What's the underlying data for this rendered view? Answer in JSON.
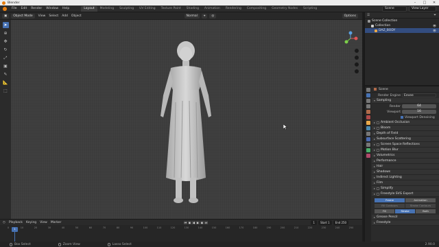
{
  "window": {
    "title": "Blender"
  },
  "menu": [
    "File",
    "Edit",
    "Render",
    "Window",
    "Help"
  ],
  "workspaces": [
    "Layout",
    "Modeling",
    "Sculpting",
    "UV Editing",
    "Texture Paint",
    "Shading",
    "Animation",
    "Rendering",
    "Compositing",
    "Geometry Nodes",
    "Scripting"
  ],
  "topright": {
    "scene": "Scene",
    "view_layer": "View Layer"
  },
  "viewport_header": {
    "mode": "Object Mode",
    "menus": [
      "View",
      "Select",
      "Add",
      "Object"
    ],
    "orientation": "Normal",
    "options": "Options"
  },
  "outliner": {
    "rows": [
      {
        "label": "Scene Collection",
        "icon_color": "#9a9a9a",
        "selected": false
      },
      {
        "label": "Collection",
        "icon_color": "#cfcfcf",
        "selected": false
      },
      {
        "label": "DAZ_BODY",
        "icon_color": "#e8a84a",
        "selected": true
      }
    ]
  },
  "properties": {
    "title": "Scene",
    "render_engine": {
      "label": "Render Engine",
      "value": "Eevee"
    },
    "sampling": {
      "label": "Sampling",
      "render_label": "Render",
      "render_value": "64",
      "viewport_label": "Viewport",
      "viewport_value": "16"
    },
    "viewport_denoising": "Viewport Denoising",
    "panels": [
      "Ambient Occlusion",
      "Bloom",
      "Depth of Field",
      "Subsurface Scattering",
      "Screen Space Reflections",
      "Motion Blur",
      "Volumetrics",
      "Performance",
      "Hair",
      "Shadows",
      "Indirect Lighting",
      "Film",
      "Simplify",
      "Freestyle SVG Export"
    ],
    "freestyle_modes": [
      "Frame",
      "Animation"
    ],
    "freestyle_sub": [
      "Fill Contours",
      "Stroke Contours"
    ],
    "freestyle_tabs": [
      "Fill",
      "Stroke",
      "Both"
    ],
    "panels_bottom": [
      "Grease Pencil",
      "Freestyle"
    ]
  },
  "timeline": {
    "menus": [
      "Playback",
      "Keying",
      "View",
      "Marker"
    ],
    "current_frame": "1",
    "start_label": "Start",
    "start": "1",
    "end_label": "End",
    "end": "250",
    "ticks": [
      "0",
      "10",
      "20",
      "30",
      "40",
      "50",
      "60",
      "70",
      "80",
      "90",
      "100",
      "110",
      "120",
      "130",
      "140",
      "150",
      "160",
      "170",
      "180",
      "190",
      "200",
      "210",
      "220",
      "230",
      "240",
      "250"
    ]
  },
  "statusbar": {
    "items": [
      "Box Select",
      "Zoom View",
      "Lasso Select"
    ],
    "version": "2.90.0"
  },
  "colors": {
    "accent": "#4772b3",
    "background": "#3d3d3d",
    "orange": "#e87d0d"
  }
}
